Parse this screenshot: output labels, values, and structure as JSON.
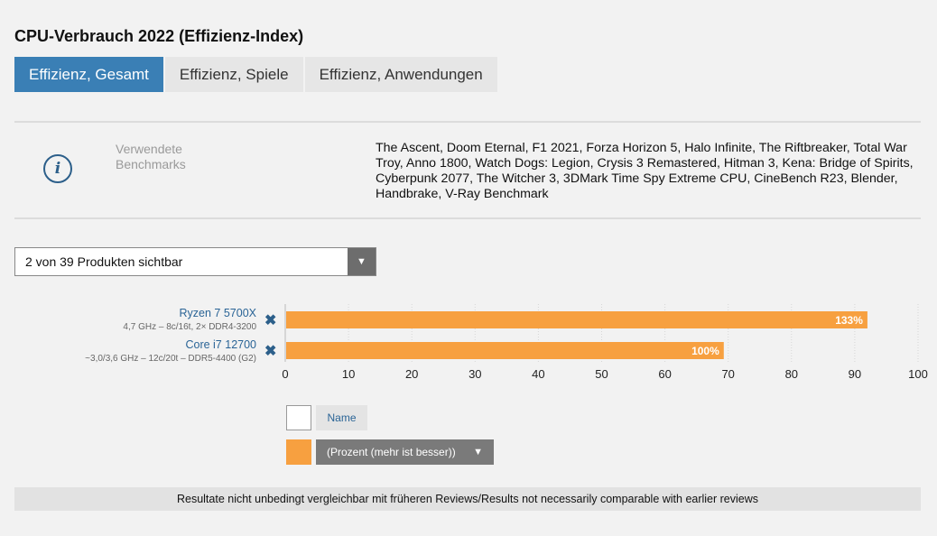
{
  "title": "CPU-Verbrauch 2022 (Effizienz-Index)",
  "tabs": [
    {
      "label": "Effizienz, Gesamt",
      "active": true
    },
    {
      "label": "Effizienz, Spiele",
      "active": false
    },
    {
      "label": "Effizienz, Anwendungen",
      "active": false
    }
  ],
  "info": {
    "icon": "info-icon",
    "label": "Verwendete Benchmarks",
    "text": "The Ascent, Doom Eternal, F1 2021, Forza Horizon 5, Halo Infinite, The Riftbreaker, Total War Troy, Anno 1800, Watch Dogs: Legion, Crysis 3 Remastered, Hitman 3, Kena: Bridge of Spirits, Cyberpunk 2077, The Witcher 3, 3DMark Time Spy Extreme CPU, CineBench R23, Blender, Handbrake, V-Ray Benchmark"
  },
  "filter": {
    "label": "2 von 39 Produkten sichtbar",
    "icon": "caret-down-icon"
  },
  "products": [
    {
      "name": "Ryzen 7 5700X",
      "spec": "4,7 GHz – 8c/16t, 2× DDR4-3200"
    },
    {
      "name": "Core i7 12700",
      "spec": "~3,0/3,6 GHz – 12c/20t – DDR5-4400 (G2)"
    }
  ],
  "legend": {
    "name_label": "Name",
    "metric_label": "(Prozent (mehr ist besser))",
    "metric_color": "#f7a040"
  },
  "footer": "Resultate nicht unbedingt vergleichbar mit früheren Reviews/Results not necessarily comparable with earlier reviews",
  "chart_data": {
    "type": "bar",
    "orientation": "horizontal",
    "categories": [
      "Ryzen 7 5700X",
      "Core i7 12700"
    ],
    "values": [
      92,
      69.3
    ],
    "data_labels": [
      "133%",
      "100%"
    ],
    "xlim": [
      0,
      100
    ],
    "xticks": [
      0,
      10,
      20,
      30,
      40,
      50,
      60,
      70,
      80,
      90,
      100
    ],
    "bar_color": "#f7a040",
    "grid": true
  }
}
